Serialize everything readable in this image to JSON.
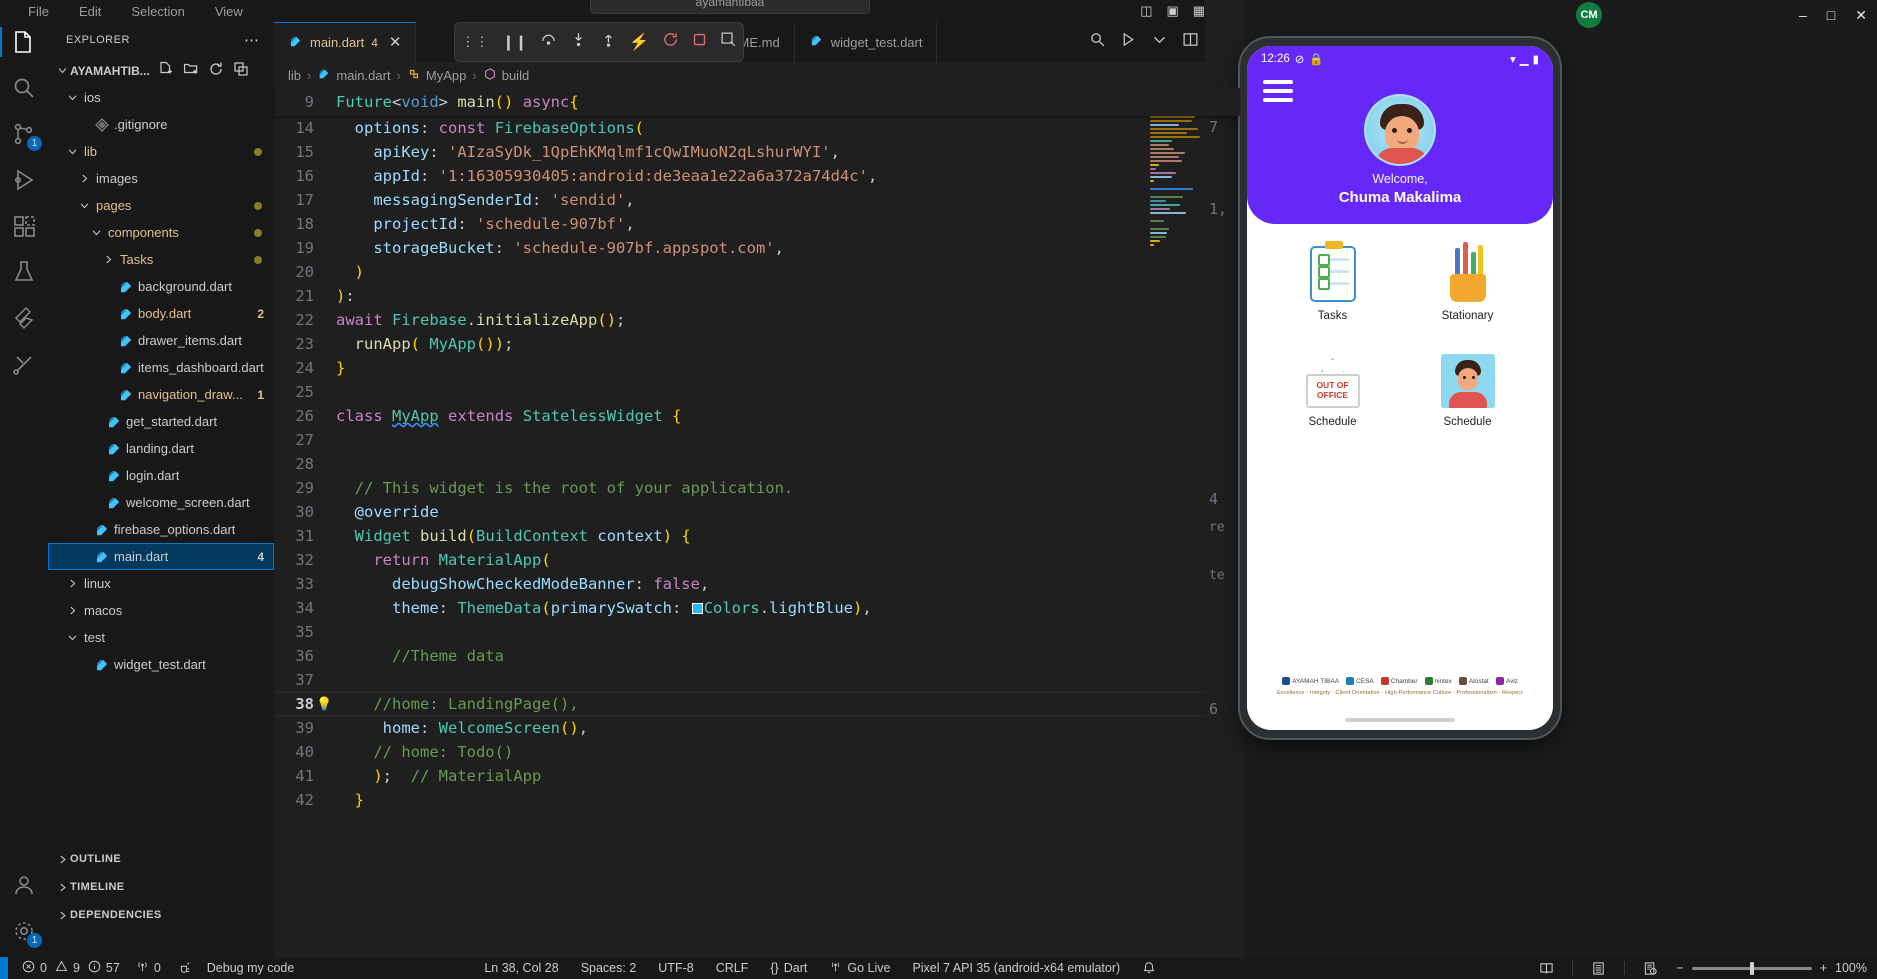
{
  "menubar": {
    "items": [
      "File",
      "Edit",
      "Selection",
      "View"
    ],
    "search_placeholder": "ayamahtibaa",
    "back_icon": "chevron-left-icon",
    "forward_icon": "chevron-right-icon",
    "layout_icons": [
      "layout-panel-icon",
      "layout-sidebar-icon",
      "layout-grid-icon"
    ],
    "close_label": "✕"
  },
  "activitybar": {
    "items": [
      {
        "name": "explorer",
        "icon": "files-icon",
        "badge": ""
      },
      {
        "name": "search",
        "icon": "search-icon",
        "badge": ""
      },
      {
        "name": "source-control",
        "icon": "source-control-icon",
        "badge": "1"
      },
      {
        "name": "run-and-debug",
        "icon": "debug-icon",
        "badge": ""
      },
      {
        "name": "extensions",
        "icon": "extensions-icon",
        "badge": ""
      },
      {
        "name": "testing",
        "icon": "beaker-icon",
        "badge": ""
      },
      {
        "name": "flutter",
        "icon": "flutter-icon",
        "badge": ""
      },
      {
        "name": "remote-explorer",
        "icon": "remote-icon",
        "badge": ""
      }
    ],
    "bottom": [
      {
        "name": "accounts",
        "icon": "account-icon",
        "badge": ""
      },
      {
        "name": "settings",
        "icon": "gear-icon",
        "badge": "1"
      }
    ]
  },
  "explorer": {
    "title": "EXPLORER",
    "more_label": "⋯",
    "root": {
      "label": "AYAMAHTIB...",
      "actions": [
        "new-file-icon",
        "new-folder-icon",
        "refresh-icon",
        "collapse-all-icon"
      ]
    },
    "tree": [
      {
        "label": "ios",
        "type": "folder",
        "expanded": true,
        "indent": 1,
        "badge": "",
        "dirty": false,
        "dot": false
      },
      {
        "label": ".gitignore",
        "type": "git",
        "expanded": null,
        "indent": 2,
        "badge": "",
        "dirty": false,
        "dot": false
      },
      {
        "label": "lib",
        "type": "folder",
        "expanded": true,
        "indent": 1,
        "badge": "",
        "dirty": true,
        "dot": true
      },
      {
        "label": "images",
        "type": "folder",
        "expanded": false,
        "indent": 2,
        "badge": "",
        "dirty": false,
        "dot": false
      },
      {
        "label": "pages",
        "type": "folder",
        "expanded": true,
        "indent": 2,
        "badge": "",
        "dirty": true,
        "dot": true
      },
      {
        "label": "components",
        "type": "folder",
        "expanded": true,
        "indent": 3,
        "badge": "",
        "dirty": true,
        "dot": true
      },
      {
        "label": "Tasks",
        "type": "folder",
        "expanded": false,
        "indent": 4,
        "badge": "",
        "dirty": true,
        "dot": true
      },
      {
        "label": "background.dart",
        "type": "dart",
        "expanded": null,
        "indent": 4,
        "badge": "",
        "dirty": false,
        "dot": false
      },
      {
        "label": "body.dart",
        "type": "dart",
        "expanded": null,
        "indent": 4,
        "badge": "2",
        "dirty": true,
        "dot": false
      },
      {
        "label": "drawer_items.dart",
        "type": "dart",
        "expanded": null,
        "indent": 4,
        "badge": "",
        "dirty": false,
        "dot": false
      },
      {
        "label": "items_dashboard.dart",
        "type": "dart",
        "expanded": null,
        "indent": 4,
        "badge": "",
        "dirty": false,
        "dot": false
      },
      {
        "label": "navigation_draw...",
        "type": "dart",
        "expanded": null,
        "indent": 4,
        "badge": "1",
        "dirty": true,
        "dot": false
      },
      {
        "label": "get_started.dart",
        "type": "dart",
        "expanded": null,
        "indent": 3,
        "badge": "",
        "dirty": false,
        "dot": false
      },
      {
        "label": "landing.dart",
        "type": "dart",
        "expanded": null,
        "indent": 3,
        "badge": "",
        "dirty": false,
        "dot": false
      },
      {
        "label": "login.dart",
        "type": "dart",
        "expanded": null,
        "indent": 3,
        "badge": "",
        "dirty": false,
        "dot": false
      },
      {
        "label": "welcome_screen.dart",
        "type": "dart",
        "expanded": null,
        "indent": 3,
        "badge": "",
        "dirty": false,
        "dot": false
      },
      {
        "label": "firebase_options.dart",
        "type": "dart",
        "expanded": null,
        "indent": 2,
        "badge": "",
        "dirty": false,
        "dot": false
      },
      {
        "label": "main.dart",
        "type": "dart",
        "expanded": null,
        "indent": 2,
        "badge": "4",
        "dirty": false,
        "dot": false,
        "selected": true
      },
      {
        "label": "linux",
        "type": "folder",
        "expanded": false,
        "indent": 1,
        "badge": "",
        "dirty": false,
        "dot": false
      },
      {
        "label": "macos",
        "type": "folder",
        "expanded": false,
        "indent": 1,
        "badge": "",
        "dirty": false,
        "dot": false
      },
      {
        "label": "test",
        "type": "folder",
        "expanded": true,
        "indent": 1,
        "badge": "",
        "dirty": false,
        "dot": false
      },
      {
        "label": "widget_test.dart",
        "type": "dart",
        "expanded": null,
        "indent": 2,
        "badge": "",
        "dirty": false,
        "dot": false
      }
    ],
    "sections": [
      "OUTLINE",
      "TIMELINE",
      "DEPENDENCIES"
    ]
  },
  "editor": {
    "tabs": [
      {
        "label": "main.dart",
        "badge": "4",
        "active": true,
        "closable": true
      },
      {
        "label": "ADME.md",
        "badge": "",
        "active": false,
        "closable": false
      },
      {
        "label": "widget_test.dart",
        "badge": "",
        "active": false,
        "closable": false
      }
    ],
    "actions": [
      "search-icon",
      "run-debug-icon",
      "chevron-down-icon",
      "split-editor-icon",
      "more-actions-icon"
    ],
    "toolbar_icons": [
      "drag-handle-icon",
      "pause-icon",
      "step-over-icon",
      "step-into-icon",
      "step-out-icon",
      "hot-reload-icon",
      "restart-icon",
      "stop-icon",
      "inspect-icon"
    ],
    "breadcrumb": [
      "lib",
      "main.dart",
      "MyApp",
      "build"
    ],
    "sticky_line": {
      "num": "9",
      "text": "Future<void> main() async{"
    },
    "lines": [
      {
        "num": "14",
        "text": "  options: const FirebaseOptions("
      },
      {
        "num": "15",
        "text": "    apiKey: 'AIzaSyDk_1QpEhKMqlmf1cQwIMuoN2qLshurWYI',"
      },
      {
        "num": "16",
        "text": "    appId: '1:16305930405:android:de3eaa1e22a6a372a74d4c',"
      },
      {
        "num": "17",
        "text": "    messagingSenderId: 'sendid',"
      },
      {
        "num": "18",
        "text": "    projectId: 'schedule-907bf',"
      },
      {
        "num": "19",
        "text": "    storageBucket: 'schedule-907bf.appspot.com',"
      },
      {
        "num": "20",
        "text": "  )"
      },
      {
        "num": "21",
        "text": "):"
      },
      {
        "num": "22",
        "text": "await Firebase.initializeApp();"
      },
      {
        "num": "23",
        "text": "  runApp( MyApp());"
      },
      {
        "num": "24",
        "text": "}"
      },
      {
        "num": "25",
        "text": ""
      },
      {
        "num": "26",
        "text": "class MyApp extends StatelessWidget {"
      },
      {
        "num": "27",
        "text": ""
      },
      {
        "num": "28",
        "text": ""
      },
      {
        "num": "29",
        "text": "  // This widget is the root of your application."
      },
      {
        "num": "30",
        "text": "  @override"
      },
      {
        "num": "31",
        "text": "  Widget build(BuildContext context) {"
      },
      {
        "num": "32",
        "text": "    return MaterialApp("
      },
      {
        "num": "33",
        "text": "      debugShowCheckedModeBanner: false,"
      },
      {
        "num": "34",
        "text": "      theme: ThemeData(primarySwatch: Colors.lightBlue),"
      },
      {
        "num": "35",
        "text": ""
      },
      {
        "num": "36",
        "text": "      //Theme data"
      },
      {
        "num": "37",
        "text": ""
      },
      {
        "num": "38",
        "text": "    //home: LandingPage(),"
      },
      {
        "num": "39",
        "text": "     home: WelcomeScreen(),"
      },
      {
        "num": "40",
        "text": "    // home: Todo()"
      },
      {
        "num": "41",
        "text": "    );  // MaterialApp"
      },
      {
        "num": "42",
        "text": "  }"
      }
    ]
  },
  "rightcol": {
    "markers": [
      "7",
      "1,",
      "4",
      "re",
      "te",
      "6"
    ]
  },
  "emulator": {
    "window_title": "",
    "avatar_initials": "CM",
    "window_controls": [
      "minimize-icon",
      "maximize-icon",
      "close-icon"
    ],
    "phone": {
      "status": {
        "time": "12:26",
        "icons": [
          "dnd-icon",
          "vpn-icon",
          "wifi-icon",
          "signal-icon",
          "battery-icon"
        ]
      },
      "menu_icon": "hamburger-menu-icon",
      "welcome_small": "Welcome,",
      "welcome_name": "Chuma Makalima",
      "tiles": [
        {
          "label": "Tasks",
          "art": "clipboard-icon"
        },
        {
          "label": "Stationary",
          "art": "pencil-cup-icon"
        },
        {
          "label": "Schedule",
          "art": "out-of-office-sign-icon",
          "sign_line1": "OUT OF",
          "sign_line2": "OFFICE"
        },
        {
          "label": "Schedule",
          "art": "person-photo-icon"
        }
      ],
      "footer_logos": [
        "AYAMAH TIBAA",
        "CESA",
        "Chamber",
        "nintex",
        "Alostat",
        "Aviz"
      ],
      "footer_tagline": "Excellence · Integrity · Client Orientation · High-Performance Culture · Professionalism · Respect"
    }
  },
  "statusbar": {
    "errors_icon": "error-icon",
    "errors": "0",
    "warnings_icon": "warning-icon",
    "warnings": "9",
    "info_icon": "info-icon",
    "info": "57",
    "ports_icon": "radio-tower-icon",
    "ports": "0",
    "debug_icon": "debug-alt-icon",
    "debug_label": "Debug my code",
    "cursor": "Ln 38, Col 28",
    "spaces": "Spaces: 2",
    "encoding": "UTF-8",
    "eol": "CRLF",
    "language": "Dart",
    "language_icon": "braces-icon",
    "golive_icon": "broadcast-icon",
    "golive": "Go Live",
    "device": "Pixel 7 API 35 (android-x64 emulator)",
    "bell_icon": "bell-icon",
    "tray_icons": [
      "book-icon",
      "list-icon",
      "globe-doc-icon"
    ],
    "zoom_minus": "−",
    "zoom_plus": "+",
    "zoom_level": "100%"
  }
}
